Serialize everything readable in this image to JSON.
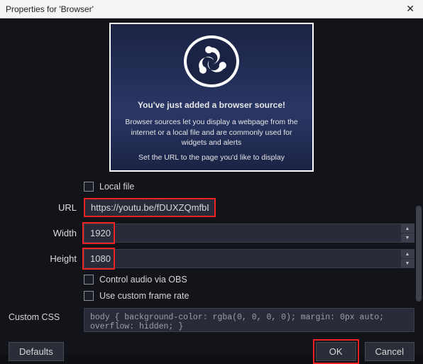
{
  "titlebar": {
    "title": "Properties for 'Browser'"
  },
  "intro": {
    "heading": "You've just added a browser source!",
    "desc": "Browser sources let you display a webpage from the internet or a local file and are commonly used for widgets and alerts",
    "hint": "Set the URL to the page you'd like to display"
  },
  "form": {
    "local_file_label": "Local file",
    "url_label": "URL",
    "url_value": "https://youtu.be/fDUXZQmfbLM",
    "width_label": "Width",
    "width_value": "1920",
    "height_label": "Height",
    "height_value": "1080",
    "control_audio_label": "Control audio via OBS",
    "custom_rate_label": "Use custom frame rate",
    "custom_css_label": "Custom CSS",
    "custom_css_value": "body { background-color: rgba(0, 0, 0, 0); margin: 0px auto; overflow: hidden; }"
  },
  "footer": {
    "defaults": "Defaults",
    "ok": "OK",
    "cancel": "Cancel"
  }
}
